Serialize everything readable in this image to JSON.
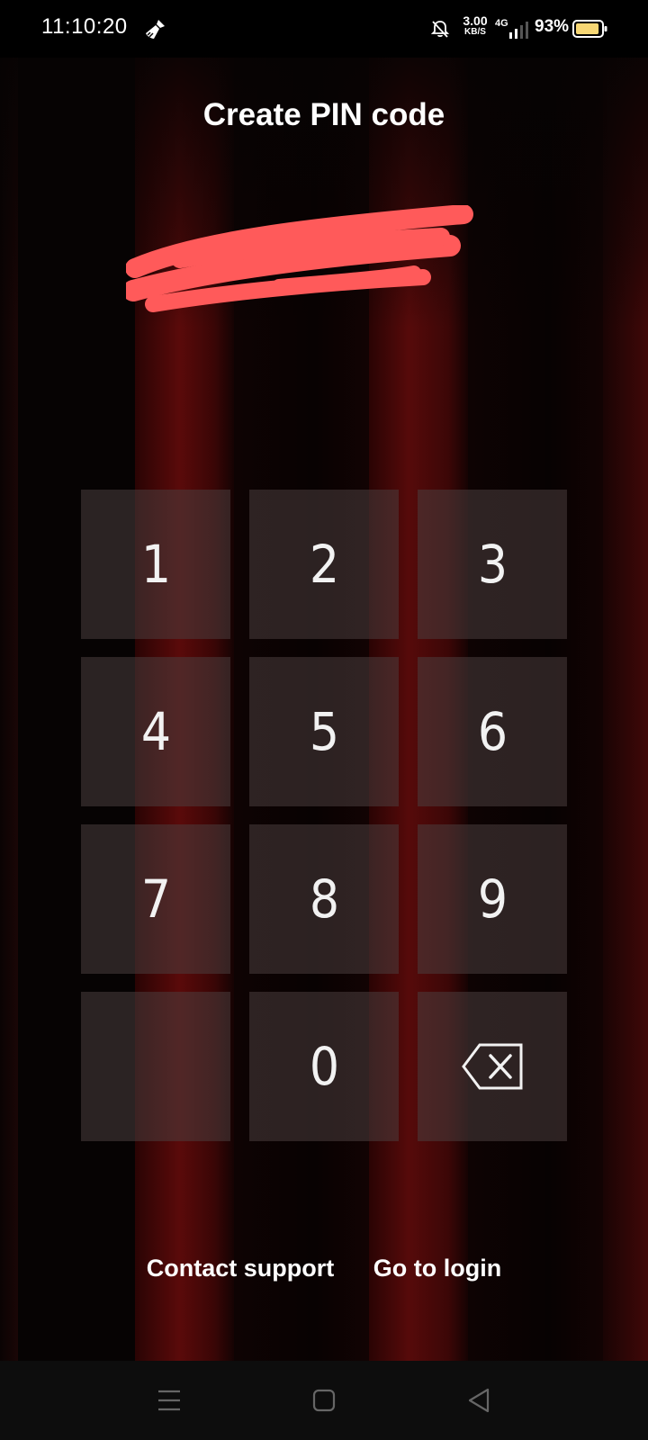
{
  "status_bar": {
    "time": "11:10:20",
    "net_speed_value": "3.00",
    "net_speed_unit": "KB/S",
    "network_type": "4G",
    "battery_percent": "93%",
    "battery_level": 0.93,
    "icons": [
      "broom-icon",
      "bell-off-icon",
      "signal-icon",
      "battery-icon"
    ]
  },
  "screen": {
    "title": "Create PIN code"
  },
  "keypad": {
    "keys": [
      "1",
      "2",
      "3",
      "4",
      "5",
      "6",
      "7",
      "8",
      "9",
      "",
      "0"
    ],
    "backspace_icon": "backspace-icon"
  },
  "links": {
    "contact_support": "Contact support",
    "go_to_login": "Go to login"
  },
  "nav_bar": {
    "icons": [
      "menu-icon",
      "home-icon",
      "back-icon"
    ]
  },
  "colors": {
    "background": "#060303",
    "stripe_red": "#5a0a0a",
    "key_fill": "#4b3e3e",
    "scribble": "#ff5a5a",
    "battery_fill": "#f7d774"
  }
}
